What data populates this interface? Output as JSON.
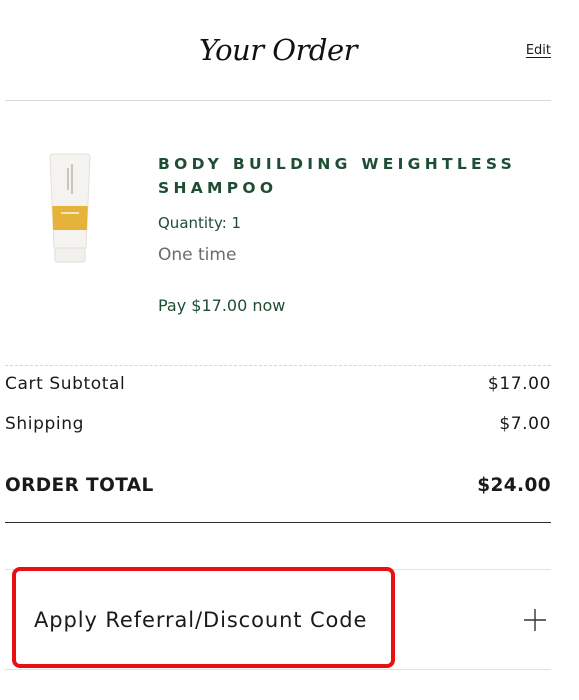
{
  "header": {
    "title": "Your Order",
    "edit_label": "Edit"
  },
  "product": {
    "name": "BODY BUILDING WEIGHTLESS SHAMPOO",
    "quantity": "Quantity: 1",
    "frequency": "One time",
    "pay_now": "Pay $17.00 now",
    "image_icon": "shampoo-tube-image"
  },
  "summary": {
    "subtotal_label": "Cart Subtotal",
    "subtotal_value": "$17.00",
    "shipping_label": "Shipping",
    "shipping_value": "$7.00",
    "total_label": "ORDER TOTAL",
    "total_value": "$24.00"
  },
  "discount": {
    "label": "Apply Referral/Discount Code",
    "icon": "plus-icon"
  },
  "colors": {
    "brand_green": "#1f4d33",
    "highlight_red": "#e81010",
    "tube_accent": "#e6b33a"
  }
}
